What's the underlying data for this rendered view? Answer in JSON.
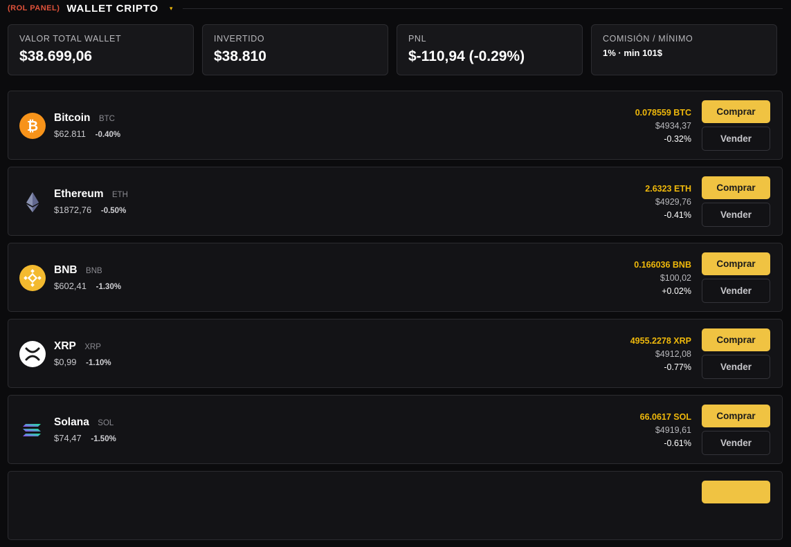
{
  "header": {
    "rol_label": "(ROL PANEL)",
    "title": "WALLET CRIPTO",
    "caret": "▾"
  },
  "stats": [
    {
      "label": "VALOR TOTAL WALLET",
      "value": "$38.699,06"
    },
    {
      "label": "INVERTIDO",
      "value": "$38.810"
    },
    {
      "label": "PNL",
      "value": "$-110,94 (-0.29%)"
    },
    {
      "label": "COMISIÓN / MÍNIMO",
      "value": "1% · min 101$"
    }
  ],
  "coins": [
    {
      "name": "Bitcoin",
      "symbol": "BTC",
      "price": "$62.811",
      "change": "-0.40%",
      "amount": "0.078559 BTC",
      "usd": "$4934,37",
      "pct": "-0.32%",
      "icon": "bitcoin-icon",
      "color": "#f7931a"
    },
    {
      "name": "Ethereum",
      "symbol": "ETH",
      "price": "$1872,76",
      "change": "-0.50%",
      "amount": "2.6323 ETH",
      "usd": "$4929,76",
      "pct": "-0.41%",
      "icon": "ethereum-icon",
      "color": "#627eea"
    },
    {
      "name": "BNB",
      "symbol": "BNB",
      "price": "$602,41",
      "change": "-1.30%",
      "amount": "0.166036 BNB",
      "usd": "$100,02",
      "pct": "+0.02%",
      "icon": "bnb-icon",
      "color": "#f3ba2f"
    },
    {
      "name": "XRP",
      "symbol": "XRP",
      "price": "$0,99",
      "change": "-1.10%",
      "amount": "4955.2278 XRP",
      "usd": "$4912,08",
      "pct": "-0.77%",
      "icon": "xrp-icon",
      "color": "#ffffff"
    },
    {
      "name": "Solana",
      "symbol": "SOL",
      "price": "$74,47",
      "change": "-1.50%",
      "amount": "66.0617 SOL",
      "usd": "$4919,61",
      "pct": "-0.61%",
      "icon": "solana-icon",
      "color": "#9945ff"
    }
  ],
  "buttons": {
    "buy": "Comprar",
    "sell": "Vender"
  },
  "colors": {
    "accent": "#f0b90b",
    "buy_button": "#f0c342",
    "background": "#0b0b0d"
  }
}
